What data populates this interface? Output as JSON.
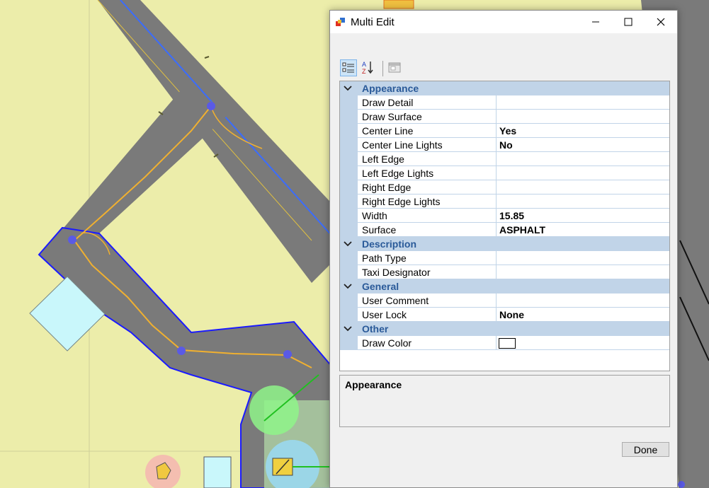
{
  "window": {
    "title": "Multi Edit"
  },
  "toolbar": {
    "categorized_icon": "categorized-view-icon",
    "alphabetical_icon": "alphabetical-sort-icon",
    "property_pages_icon": "property-pages-icon"
  },
  "property_grid": {
    "categories": [
      {
        "label": "Appearance",
        "properties": [
          {
            "name": "Draw Detail",
            "value": ""
          },
          {
            "name": "Draw Surface",
            "value": ""
          },
          {
            "name": "Center Line",
            "value": "Yes"
          },
          {
            "name": "Center Line Lights",
            "value": "No"
          },
          {
            "name": "Left Edge",
            "value": ""
          },
          {
            "name": "Left Edge Lights",
            "value": ""
          },
          {
            "name": "Right Edge",
            "value": ""
          },
          {
            "name": "Right Edge Lights",
            "value": ""
          },
          {
            "name": "Width",
            "value": "15.85"
          },
          {
            "name": "Surface",
            "value": "ASPHALT"
          }
        ]
      },
      {
        "label": "Description",
        "properties": [
          {
            "name": "Path Type",
            "value": ""
          },
          {
            "name": "Taxi Designator",
            "value": ""
          }
        ]
      },
      {
        "label": "General",
        "properties": [
          {
            "name": "User Comment",
            "value": ""
          },
          {
            "name": "User Lock",
            "value": "None"
          }
        ]
      },
      {
        "label": "Other",
        "properties": [
          {
            "name": "Draw Color",
            "value": "",
            "color": "#ffffff"
          }
        ]
      }
    ]
  },
  "help_panel": {
    "title": "Appearance"
  },
  "buttons": {
    "done": "Done"
  },
  "colors": {
    "ground": "#ecedaa",
    "taxiway": "#7a7a7a",
    "taxiway_edge": "#1a1aff",
    "taxi_path": "#f0b030",
    "node": "#5a5ae6",
    "category_band": "#c1d4e8",
    "category_text": "#2a5a99"
  }
}
